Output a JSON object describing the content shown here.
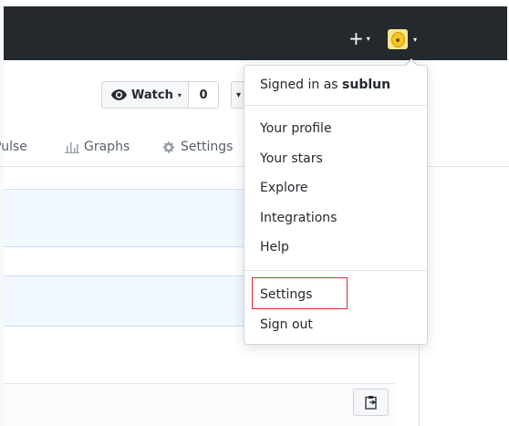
{
  "header": {
    "plus_label": "+",
    "caret": "▾"
  },
  "repo_head": {
    "watch_label": "Watch",
    "watch_count": "0",
    "star_caret": "▾"
  },
  "repo_nav": {
    "tabs": [
      {
        "label": "Pulse"
      },
      {
        "label": "Graphs"
      },
      {
        "label": "Settings"
      }
    ]
  },
  "user_menu": {
    "signed_in_prefix": "Signed in as",
    "username": "sublun",
    "items": [
      {
        "label": "Your profile"
      },
      {
        "label": "Your stars"
      },
      {
        "label": "Explore"
      },
      {
        "label": "Integrations"
      },
      {
        "label": "Help"
      }
    ],
    "settings_label": "Settings",
    "signout_label": "Sign out",
    "highlight_color": "#d72b2b"
  },
  "colors": {
    "header_bg": "#24292e",
    "box_blue_bg": "#f1f8ff"
  },
  "icons": [
    "plus-icon",
    "avatar",
    "eye-icon",
    "graph-icon",
    "gear-icon",
    "clipboard-icon"
  ]
}
